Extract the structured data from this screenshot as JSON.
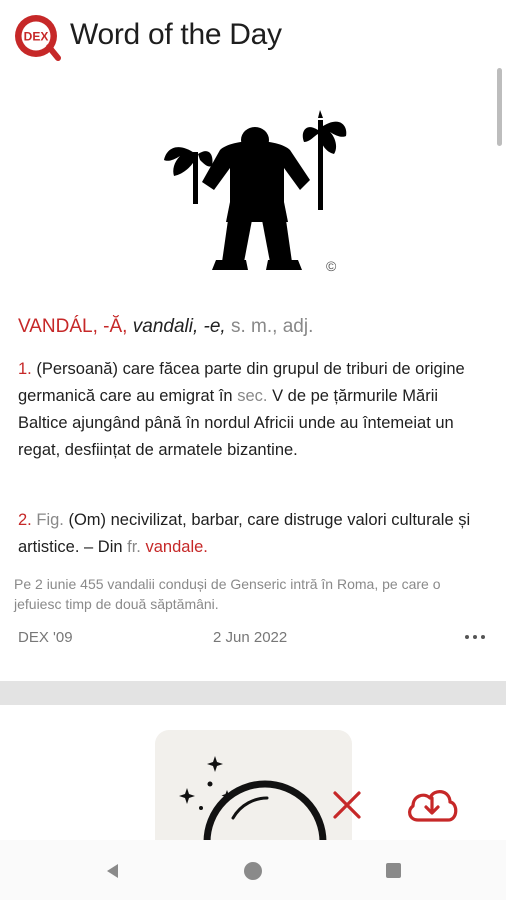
{
  "header": {
    "logo_text": "DEX",
    "title": "Word of the Day"
  },
  "illustration": {
    "copyright": "©"
  },
  "entry": {
    "headword": "VANDÁL, -Ă,",
    "forms": "vandali, -e,",
    "pos1": "s. m.,",
    "pos2": "adj.",
    "def1_num": "1.",
    "def1_part1": "(Persoană) care făcea parte din grupul de triburi de origine germanică care au emigrat în",
    "def1_abbr": "sec.",
    "def1_part2": "V de pe țărmurile Mării Baltice ajungând până în nordul Africii unde au întemeiat un regat, desființat de armatele bizantine.",
    "def2_num": "2.",
    "def2_fig": "Fig.",
    "def2_text": "(Om) necivilizat, barbar, care distruge valori culturale și artistice. – Din",
    "def2_abbr": "fr.",
    "def2_source": "vandale."
  },
  "example": "Pe 2 iunie 455 vandalii conduși de Genseric intră în Roma, pe care o jefuiesc timp de două săptămâni.",
  "meta": {
    "source": "DEX '09",
    "date": "2 Jun 2022"
  },
  "icons": {
    "logo": "dex-logo-icon",
    "more": "more-dots-icon",
    "close": "close-icon",
    "download": "cloud-download-icon",
    "crystal_ball": "crystal-ball-icon"
  },
  "colors": {
    "accent": "#c62828",
    "text": "#1f1f1f",
    "muted": "#888888"
  }
}
